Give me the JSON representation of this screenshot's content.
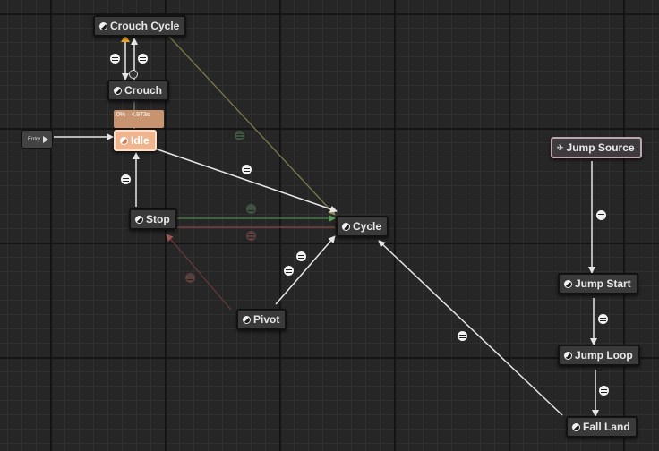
{
  "graph": {
    "entry_label": "Entry",
    "nodes": [
      {
        "id": "crouch-cycle",
        "label": "Crouch Cycle"
      },
      {
        "id": "crouch",
        "label": "Crouch"
      },
      {
        "id": "idle",
        "label": "Idle"
      },
      {
        "id": "stop",
        "label": "Stop"
      },
      {
        "id": "cycle",
        "label": "Cycle"
      },
      {
        "id": "pivot",
        "label": "Pivot"
      },
      {
        "id": "jump-source",
        "label": "Jump Source"
      },
      {
        "id": "jump-start",
        "label": "Jump Start"
      },
      {
        "id": "jump-loop",
        "label": "Jump Loop"
      },
      {
        "id": "fall-land",
        "label": "Fall Land"
      }
    ],
    "active_state": "Idle",
    "active_tooltip": "0% · 4.973s"
  },
  "colors": {
    "active_node": "#f0b48e",
    "transition_wire": "#e0e0e0",
    "crouch_wire": "#7a7a4a",
    "recent_green": "#4a8a4a",
    "recent_red": "#8a4a4a"
  }
}
